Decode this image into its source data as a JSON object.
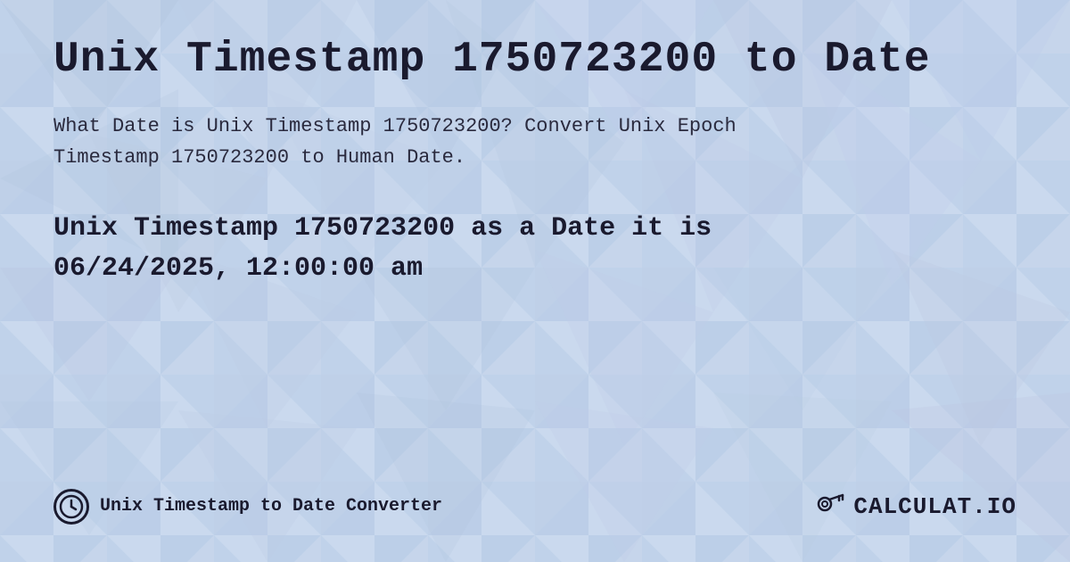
{
  "page": {
    "title": "Unix Timestamp 1750723200 to Date",
    "description_part1": "What Date is Unix Timestamp 1750723200? Convert Unix Epoch",
    "description_part2": "Timestamp 1750723200 to Human Date.",
    "result_line1": "Unix Timestamp 1750723200 as a Date it is",
    "result_line2": "06/24/2025, 12:00:00 am",
    "footer_label": "Unix Timestamp to Date Converter",
    "logo_text": "CALCULAT.IO"
  },
  "colors": {
    "background": "#c8d8f0",
    "text_dark": "#1a1a2e",
    "triangle_light": "#b8cce8",
    "triangle_medium": "#a8bcdc"
  }
}
